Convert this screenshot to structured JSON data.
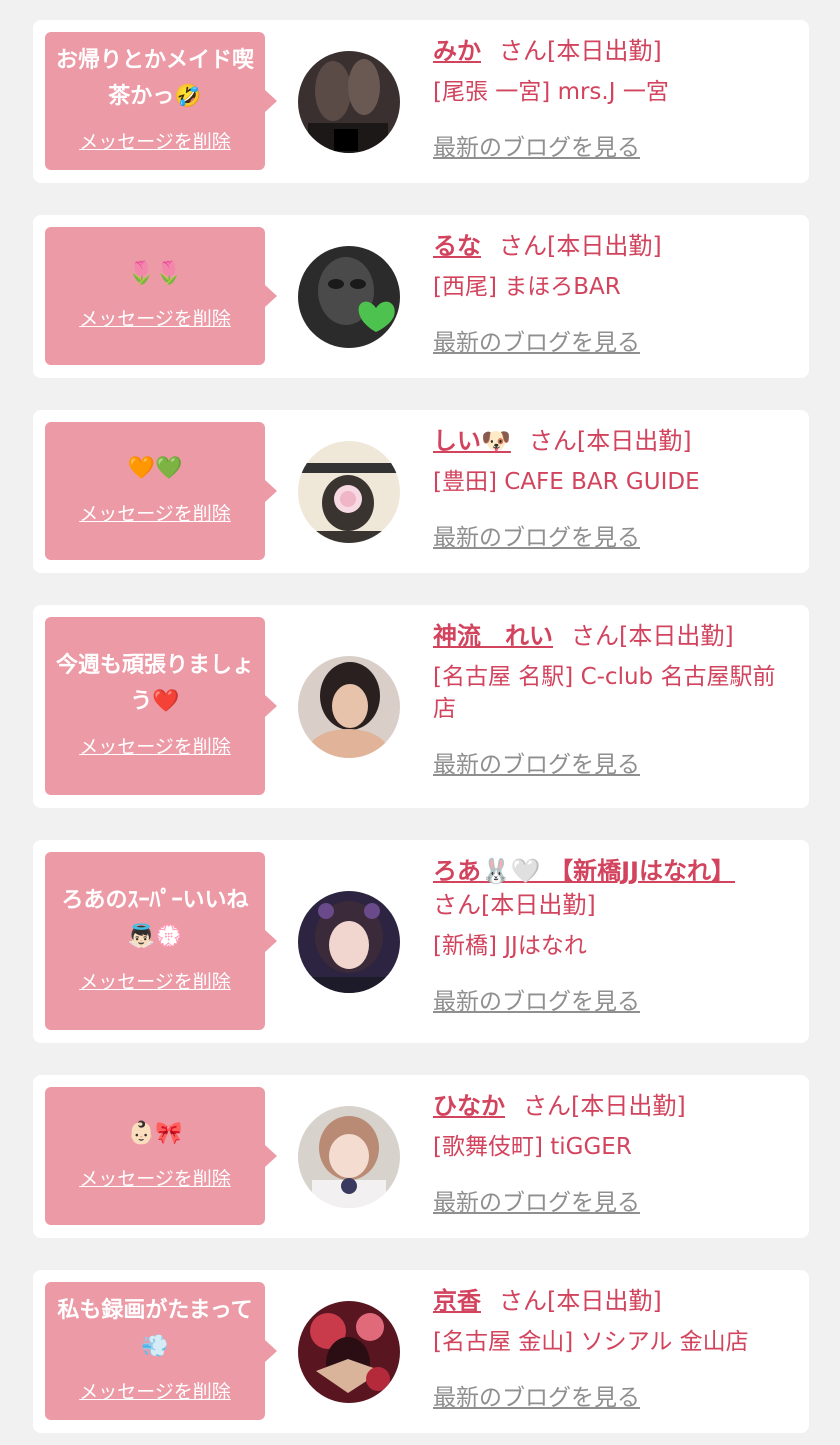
{
  "labels": {
    "delete": "メッセージを削除",
    "blog": "最新のブログを見る",
    "suffix": "さん[本日出勤]"
  },
  "colors": {
    "background": "#f1f1f2",
    "card": "#ffffff",
    "bubble": "#ec9aa6",
    "accent": "#d2445e",
    "link_gray": "#8f8f8f"
  },
  "entries": [
    {
      "message": "お帰りとかメイド喫茶かっ🤣",
      "name": "みか",
      "shop": "[尾張 一宮] mrs.J 一宮"
    },
    {
      "message": "🌷🌷",
      "name": "るな",
      "shop": "[西尾] まほろBAR"
    },
    {
      "message": "🧡💚",
      "name": "しい🐶",
      "shop": "[豊田] CAFE BAR GUIDE"
    },
    {
      "message": "今週も頑張りましょう❤️",
      "name": "神流　れい",
      "shop": "[名古屋 名駅] C-club 名古屋駅前店"
    },
    {
      "message": "ろあのｽｰﾊﾟｰいいね👼🏻💮",
      "name": "ろあ🐰🤍 【新橋JJはなれ】",
      "shop": "[新橋] JJはなれ"
    },
    {
      "message": "👶🏻🎀",
      "name": "ひなか",
      "shop": "[歌舞伎町] tiGGER"
    },
    {
      "message": "私も録画がたまって💨",
      "name": "京香",
      "shop": "[名古屋 金山] ソシアル 金山店"
    }
  ]
}
